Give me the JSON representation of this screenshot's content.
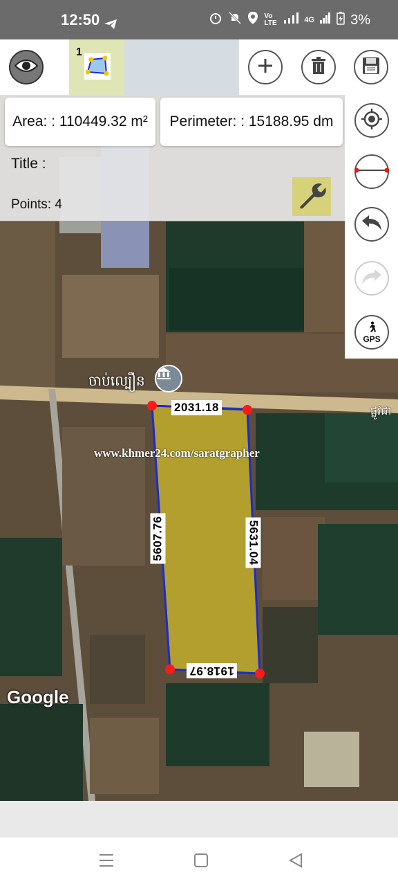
{
  "status_bar": {
    "time": "12:50",
    "battery_pct": "3%",
    "network": "4G",
    "volte": "Vo LTE"
  },
  "toolbar": {
    "shape_tab_number": "1",
    "icons": [
      "eye-icon",
      "polygon-icon",
      "add-icon",
      "trash-icon",
      "save-icon"
    ]
  },
  "info": {
    "area": "Area: : 110449.32 m²",
    "perimeter": "Perimeter: : 15188.95 dm",
    "title": "Title :",
    "points": "Points: 4"
  },
  "side_tools": [
    "locate-icon",
    "measure-line-icon",
    "undo-icon",
    "redo-icon",
    "gps-icon"
  ],
  "gps_label": "GPS",
  "map": {
    "place_name": "ចាប់ល្បឿន",
    "road_label": "ផ្លូវជា",
    "watermark": "www.khmer24.com/saratgrapher",
    "attribution": "Google",
    "edge_lengths": {
      "top": "2031.18",
      "right": "5631.04",
      "bottom": "1918.97",
      "left": "5607.76"
    },
    "colors": {
      "polygon_fill": "#c8b42a",
      "polygon_stroke": "#1a2bd6",
      "vertex": "#ff1a1a"
    }
  }
}
